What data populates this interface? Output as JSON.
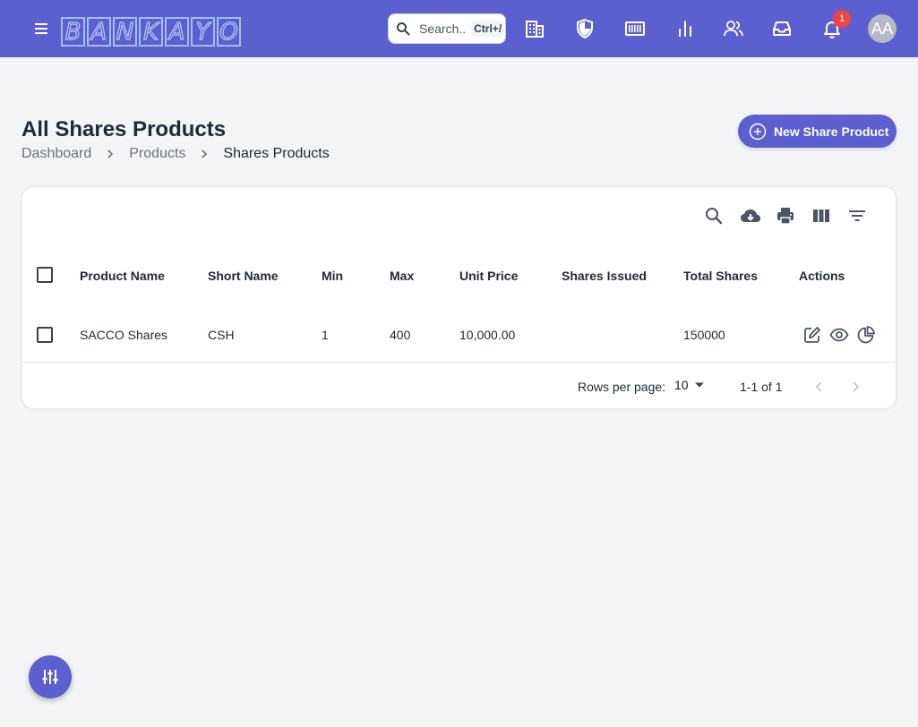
{
  "brand": {
    "letters": [
      "B",
      "A",
      "N",
      "K",
      "A",
      "Y",
      "O"
    ]
  },
  "search": {
    "placeholder": "Search..",
    "shortcut": "Ctrl+/"
  },
  "topbar_icons": [
    "building-icon",
    "shield-icon",
    "barcode-icon",
    "bar-chart-icon",
    "users-icon",
    "inbox-icon",
    "bell-icon"
  ],
  "notifications": {
    "count": "1"
  },
  "user": {
    "initials": "AA"
  },
  "page": {
    "title": "All Shares Products",
    "breadcrumb": [
      "Dashboard",
      "Products",
      "Shares Products"
    ],
    "new_button_label": "New Share Product"
  },
  "table": {
    "toolbar_icons": [
      "search-icon",
      "download-icon",
      "print-icon",
      "columns-icon",
      "filter-icon"
    ],
    "columns": [
      "Product Name",
      "Short Name",
      "Min",
      "Max",
      "Unit Price",
      "Shares Issued",
      "Total Shares",
      "Actions"
    ],
    "rows": [
      {
        "product_name": "SACCO Shares",
        "short_name": "CSH",
        "min": "1",
        "max": "400",
        "unit_price": "10,000.00",
        "shares_issued": "",
        "total_shares": "150000",
        "actions": [
          "edit-icon",
          "view-icon",
          "pie-chart-icon"
        ]
      }
    ],
    "footer": {
      "rows_per_page_label": "Rows per page:",
      "rows_per_page_value": "10",
      "range": "1-1 of 1"
    }
  },
  "colors": {
    "primary": "#5b5fcf",
    "badge": "#ef4444",
    "background": "#f3f4f6"
  }
}
